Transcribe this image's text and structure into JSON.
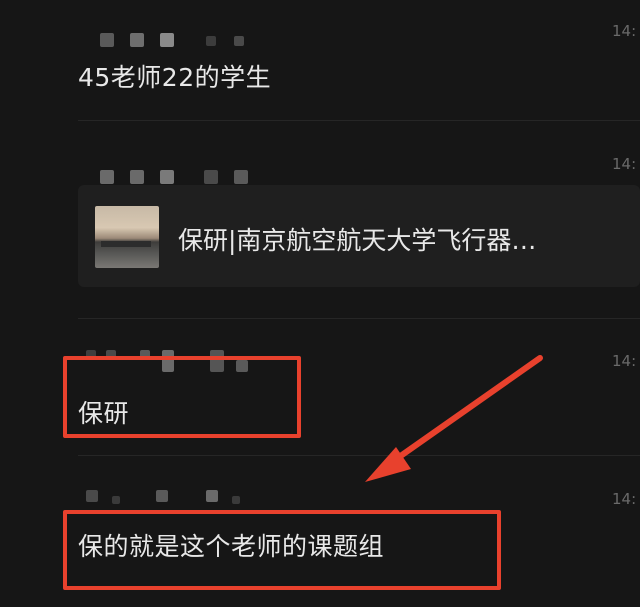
{
  "comments": [
    {
      "time": "14:",
      "text": "45老师22的学生"
    },
    {
      "time": "14:",
      "link_card": {
        "title": "保研|南京航空航天大学飞行器…",
        "thumbnail": "photo-thumbnail"
      }
    },
    {
      "time": "14:",
      "text": "保研"
    },
    {
      "time": "14:",
      "text": "保的就是这个老师的课题组"
    }
  ],
  "colors": {
    "background": "#161616",
    "highlight": "#e8412d",
    "text": "#e8e8e8",
    "card": "#1f1f1f"
  }
}
